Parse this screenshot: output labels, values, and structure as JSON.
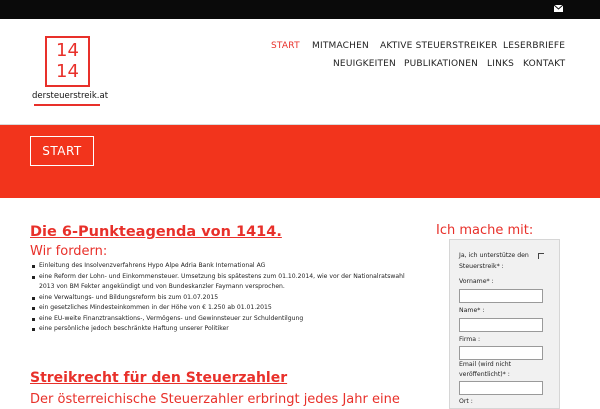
{
  "topbar": {
    "mail_icon": "envelope-icon"
  },
  "logo": {
    "number_top": "14",
    "number_bottom": "14",
    "site_name": "dersteuerstreik.at"
  },
  "nav": {
    "row1": [
      "START",
      "MITMACHEN",
      "AKTIVE STEUERSTREIKER",
      "LESERBRIEFE"
    ],
    "row2": [
      "NEUIGKEITEN",
      "PUBLIKATIONEN",
      "LINKS",
      "KONTAKT"
    ],
    "active": "START"
  },
  "banner": {
    "button_label": "START"
  },
  "main": {
    "heading": "Die 6-Punkteagenda von 1414.",
    "subheading": "Wir fordern:",
    "items": [
      "Einleitung des Insolvenzverfahrens Hypo Alpe Adria Bank International AG",
      "eine Reform der Lohn- und Einkommensteuer. Umsetzung bis spätestens zum 01.10.2014, wie vor der Nationalratswahl 2013 von BM Fekter angekündigt und von Bundeskanzler Faymann versprochen.",
      "eine Verwaltungs- und Bildungsreform bis zum 01.07.2015",
      "ein gesetzliches Mindesteinkommen in der Höhe von € 1.250 ab 01.01.2015",
      "eine EU-weite Finanztransaktions-, Vermögens- und Gewinnsteuer zur Schuldentilgung",
      "eine persönliche jedoch beschränkte Haftung unserer Politiker"
    ],
    "heading2": "Streikrecht für den Steuerzahler",
    "teaser": "Der österreichische Steuerzahler erbringt jedes Jahr eine"
  },
  "sidebar": {
    "title": "Ich mache mit:",
    "form": {
      "support_label_line1": "Ja, ich unterstütze den",
      "support_label_line2": "Steuerstreik* :",
      "firstname_label": "Vorname* :",
      "name_label": "Name* :",
      "company_label": "Firma :",
      "email_label_line1": "Email (wird nicht",
      "email_label_line2": "veröffentlicht)* :",
      "city_label": "Ort :"
    }
  }
}
